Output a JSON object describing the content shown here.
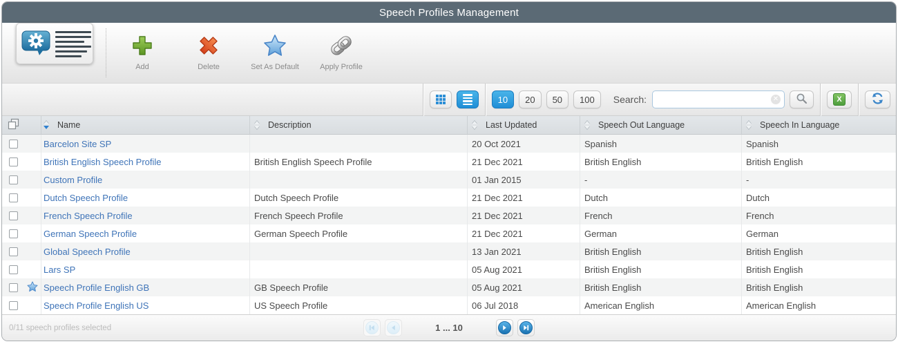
{
  "title": "Speech Profiles Management",
  "toolbar": {
    "buttons": [
      {
        "label": "Add"
      },
      {
        "label": "Delete"
      },
      {
        "label": "Set As Default"
      },
      {
        "label": "Apply Profile"
      }
    ]
  },
  "controls": {
    "page_sizes": [
      "10",
      "20",
      "50",
      "100"
    ],
    "active_page_size": "10",
    "search_label": "Search:",
    "search_value": ""
  },
  "table": {
    "columns": [
      "Name",
      "Description",
      "Last Updated",
      "Speech Out Language",
      "Speech In Language"
    ],
    "sort": {
      "column": "Name",
      "direction": "asc"
    },
    "rows": [
      {
        "name": "Barcelon Site SP",
        "description": "",
        "last_updated": "20 Oct 2021",
        "speech_out_language": "Spanish",
        "speech_in_language": "Spanish",
        "is_default": false
      },
      {
        "name": "British English Speech Profile",
        "description": "British English Speech Profile",
        "last_updated": "21 Dec 2021",
        "speech_out_language": "British English",
        "speech_in_language": "British English",
        "is_default": false
      },
      {
        "name": "Custom Profile",
        "description": "",
        "last_updated": "01 Jan 2015",
        "speech_out_language": "-",
        "speech_in_language": "-",
        "is_default": false
      },
      {
        "name": "Dutch Speech Profile",
        "description": "Dutch Speech Profile",
        "last_updated": "21 Dec 2021",
        "speech_out_language": "Dutch",
        "speech_in_language": "Dutch",
        "is_default": false
      },
      {
        "name": "French Speech Profile",
        "description": "French Speech Profile",
        "last_updated": "21 Dec 2021",
        "speech_out_language": "French",
        "speech_in_language": "French",
        "is_default": false
      },
      {
        "name": "German Speech Profile",
        "description": "German Speech Profile",
        "last_updated": "21 Dec 2021",
        "speech_out_language": "German",
        "speech_in_language": "German",
        "is_default": false
      },
      {
        "name": "Global Speech Profile",
        "description": "",
        "last_updated": "13 Jan 2021",
        "speech_out_language": "British English",
        "speech_in_language": "British English",
        "is_default": false
      },
      {
        "name": "Lars SP",
        "description": "",
        "last_updated": "05 Aug 2021",
        "speech_out_language": "British English",
        "speech_in_language": "British English",
        "is_default": false
      },
      {
        "name": "Speech Profile English GB",
        "description": "GB Speech Profile",
        "last_updated": "05 Aug 2021",
        "speech_out_language": "British English",
        "speech_in_language": "British English",
        "is_default": true
      },
      {
        "name": "Speech Profile English US",
        "description": "US Speech Profile",
        "last_updated": "06 Jul 2018",
        "speech_out_language": "American English",
        "speech_in_language": "American English",
        "is_default": false
      }
    ]
  },
  "footer": {
    "selection_status": "0/11 speech profiles selected",
    "page_indicator": "1 ... 10"
  },
  "colors": {
    "titlebar": "#5b6a75",
    "accent_blue": "#2b95dc",
    "link_blue": "#3f74b8",
    "add_green": "#6da23c",
    "delete_red": "#df541f",
    "star_blue": "#5e9fd8",
    "excel_green": "#5fae4e"
  }
}
